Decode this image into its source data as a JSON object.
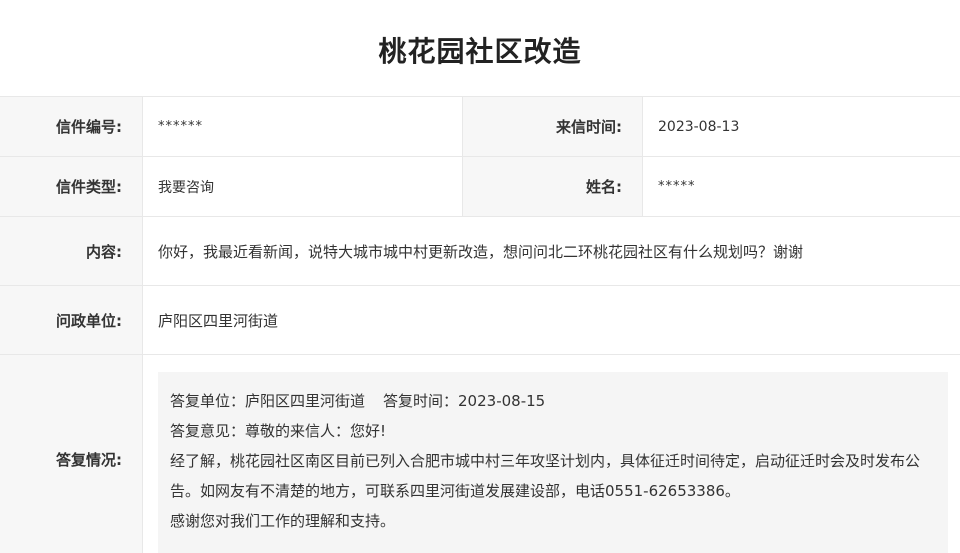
{
  "page_title": "桃花园社区改造",
  "fields": {
    "letter_no_label": "信件编号:",
    "letter_no_value": "******",
    "received_label": "来信时间:",
    "received_value": "2023-08-13",
    "type_label": "信件类型:",
    "type_value": "我要咨询",
    "name_label": "姓名:",
    "name_value": "*****",
    "content_label": "内容:",
    "content_value": "你好，我最近看新闻，说特大城市城中村更新改造，想问问北二环桃花园社区有什么规划吗？谢谢",
    "unit_label": "问政单位:",
    "unit_value": "庐阳区四里河街道",
    "reply_label": "答复情况:"
  },
  "reply": {
    "unit_text": "答复单位：庐阳区四里河街道",
    "time_text": "答复时间：2023-08-15",
    "opinion_text": "答复意见：尊敬的来信人：您好!",
    "body_text": "经了解，桃花园社区南区目前已列入合肥市城中村三年攻坚计划内，具体征迁时间待定，启动征迁时会及时发布公告。如网友有不清楚的地方，可联系四里河街道发展建设部，电话0551-62653386。",
    "thanks_text": "感谢您对我们工作的理解和支持。"
  }
}
